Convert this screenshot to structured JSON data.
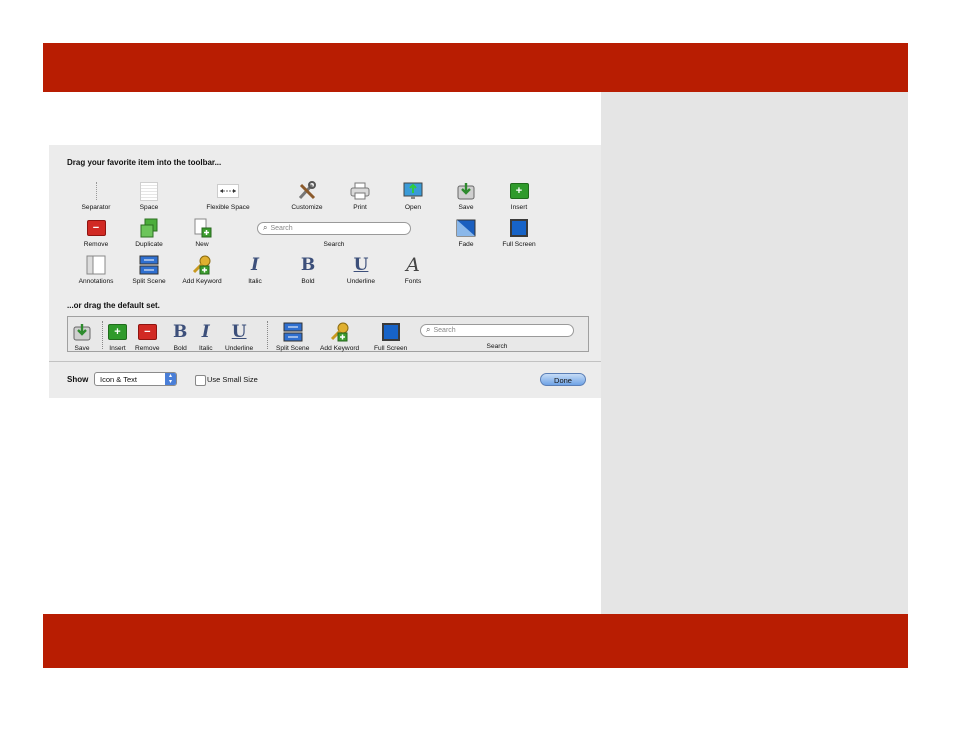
{
  "slide": {
    "accent_color": "#b81d02",
    "panel_color": "#e5e5e5"
  },
  "sheet": {
    "heading": "Drag your favorite item into the toolbar...",
    "items": [
      {
        "label": "Separator",
        "icon": "separator-icon"
      },
      {
        "label": "Space",
        "icon": "space-icon"
      },
      {
        "label": "Flexible Space",
        "icon": "flexible-space-icon"
      },
      {
        "label": "Customize",
        "icon": "customize-tools-icon"
      },
      {
        "label": "Print",
        "icon": "print-icon"
      },
      {
        "label": "Open",
        "icon": "open-icon"
      },
      {
        "label": "Save",
        "icon": "save-icon"
      },
      {
        "label": "Insert",
        "icon": "insert-icon"
      },
      {
        "label": "Remove",
        "icon": "remove-icon"
      },
      {
        "label": "Duplicate",
        "icon": "duplicate-icon"
      },
      {
        "label": "New",
        "icon": "new-document-icon"
      },
      {
        "label": "Search",
        "icon": "search-field",
        "placeholder": "Search"
      },
      {
        "label": "Fade",
        "icon": "fade-icon"
      },
      {
        "label": "Full Screen",
        "icon": "full-screen-icon"
      },
      {
        "label": "Annotations",
        "icon": "annotations-icon"
      },
      {
        "label": "Split Scene",
        "icon": "split-scene-icon"
      },
      {
        "label": "Add Keyword",
        "icon": "add-keyword-icon"
      },
      {
        "label": "Italic",
        "icon": "italic-icon",
        "glyph": "I"
      },
      {
        "label": "Bold",
        "icon": "bold-icon",
        "glyph": "B"
      },
      {
        "label": "Underline",
        "icon": "underline-icon",
        "glyph": "U"
      },
      {
        "label": "Fonts",
        "icon": "fonts-icon",
        "glyph": "A"
      }
    ],
    "default_heading": "...or drag the default set.",
    "default_items": [
      {
        "label": "Save"
      },
      {
        "label": "Insert"
      },
      {
        "label": "Remove"
      },
      {
        "label": "Bold",
        "glyph": "B"
      },
      {
        "label": "Italic",
        "glyph": "I"
      },
      {
        "label": "Underline",
        "glyph": "U"
      },
      {
        "label": "Split Scene"
      },
      {
        "label": "Add Keyword"
      },
      {
        "label": "Full Screen"
      },
      {
        "label": "Search",
        "placeholder": "Search"
      }
    ],
    "show_label": "Show",
    "show_value": "Icon & Text",
    "small_size_label": "Use Small Size",
    "done_label": "Done"
  }
}
